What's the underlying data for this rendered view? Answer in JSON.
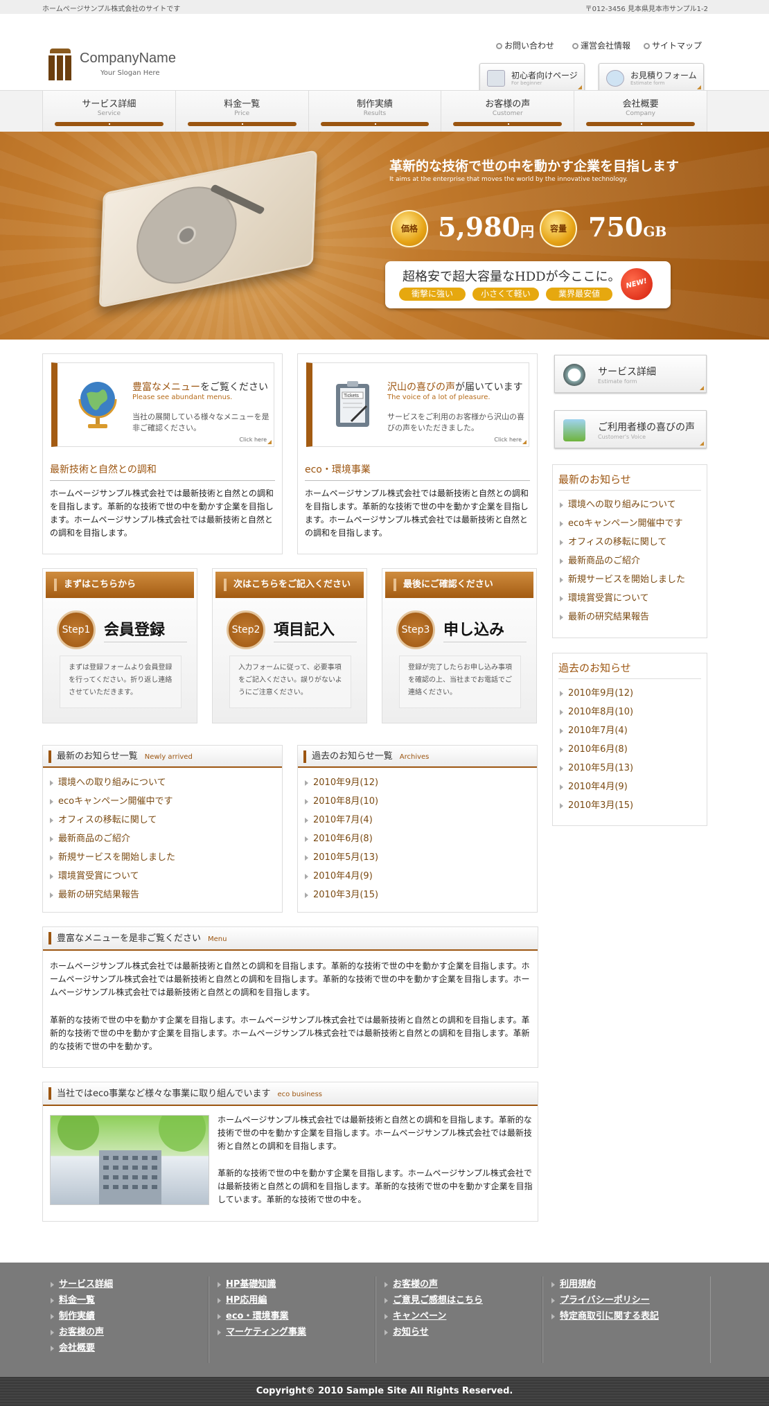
{
  "topbar": {
    "left": "ホームページサンプル株式会社のサイトです",
    "right": "〒012-3456 見本県見本市サンプル1-2"
  },
  "header": {
    "company": "CompanyName",
    "slogan": "Your Slogan Here",
    "links": [
      "お問い合わせ",
      "運営会社情報",
      "サイトマップ"
    ],
    "buttons": [
      {
        "label": "初心者向けページ",
        "sub": "For beginner"
      },
      {
        "label": "お見積りフォーム",
        "sub": "Estimate form"
      }
    ]
  },
  "nav": [
    {
      "label": "サービス詳細",
      "en": "Service"
    },
    {
      "label": "料金一覧",
      "en": "Price"
    },
    {
      "label": "制作実績",
      "en": "Results"
    },
    {
      "label": "お客様の声",
      "en": "Customer"
    },
    {
      "label": "会社概要",
      "en": "Company"
    }
  ],
  "hero": {
    "title": "革新的な技術で世の中を動かす企業を目指します",
    "subtitle": "It aims at the enterprise that moves the world by the innovative technology.",
    "price_label": "価格",
    "price_value": "5,980",
    "price_unit": "円",
    "capacity_label": "容量",
    "capacity_value": "750",
    "capacity_unit": "GB",
    "catch": "超格安で超大容量なHDDが今ここに。",
    "pills": [
      "衝撃に強い",
      "小さくて軽い",
      "業界最安値"
    ],
    "new_badge": "NEW!"
  },
  "promos": [
    {
      "title_a": "豊富なメニュー",
      "title_b": "をご覧ください",
      "sub": "Please see abundant menus.",
      "desc": "当社の展開している様々なメニューを是非ご確認ください。",
      "click": "Click here",
      "heading": "最新技術と自然との調和",
      "body": "ホームページサンプル株式会社では最新技術と自然との調和を目指します。革新的な技術で世の中を動かす企業を目指します。ホームページサンプル株式会社では最新技術と自然との調和を目指します。"
    },
    {
      "title_a": "沢山の喜びの声",
      "title_b": "が届いています",
      "sub": "The voice of a lot of pleasure.",
      "desc": "サービスをご利用のお客様から沢山の喜びの声をいただきました。",
      "click": "Click here",
      "heading": "eco・環境事業",
      "body": "ホームページサンプル株式会社では最新技術と自然との調和を目指します。革新的な技術で世の中を動かす企業を目指します。ホームページサンプル株式会社では最新技術と自然との調和を目指します。"
    }
  ],
  "steps": [
    {
      "header": "まずはこちらから",
      "badge": "Step1",
      "title": "会員登録",
      "desc": "まずは登録フォームより会員登録を行ってください。折り返し連絡させていただきます。"
    },
    {
      "header": "次はこちらをご記入ください",
      "badge": "Step2",
      "title": "項目記入",
      "desc": "入力フォームに従って、必要事項をご記入ください。誤りがないようにご注意ください。"
    },
    {
      "header": "最後にご確認ください",
      "badge": "Step3",
      "title": "申し込み",
      "desc": "登録が完了したらお申し込み事項を確認の上、当社までお電話でご連絡ください。"
    }
  ],
  "news": {
    "title": "最新のお知らせ一覧",
    "en": "Newly arrived",
    "items": [
      "環境への取り組みについて",
      "ecoキャンペーン開催中です",
      "オフィスの移転に関して",
      "最新商品のご紹介",
      "新規サービスを開始しました",
      "環境賞受賞について",
      "最新の研究結果報告"
    ]
  },
  "archives": {
    "title": "過去のお知らせ一覧",
    "en": "Archives",
    "items": [
      "2010年9月(12)",
      "2010年8月(10)",
      "2010年7月(4)",
      "2010年6月(8)",
      "2010年5月(13)",
      "2010年4月(9)",
      "2010年3月(15)"
    ]
  },
  "menu_section": {
    "title": "豊富なメニューを是非ご覧ください",
    "en": "Menu",
    "p1": "ホームページサンプル株式会社では最新技術と自然との調和を目指します。革新的な技術で世の中を動かす企業を目指します。ホームページサンプル株式会社では最新技術と自然との調和を目指します。革新的な技術で世の中を動かす企業を目指します。ホームページサンプル株式会社では最新技術と自然との調和を目指します。",
    "p2": "革新的な技術で世の中を動かす企業を目指します。ホームページサンプル株式会社では最新技術と自然との調和を目指します。革新的な技術で世の中を動かす企業を目指します。ホームページサンプル株式会社では最新技術と自然との調和を目指します。革新的な技術で世の中を動かす。"
  },
  "eco_section": {
    "title": "当社ではeco事業など様々な事業に取り組んでいます",
    "en": "eco business",
    "p1": "ホームページサンプル株式会社では最新技術と自然との調和を目指します。革新的な技術で世の中を動かす企業を目指します。ホームページサンプル株式会社では最新技術と自然との調和を目指します。",
    "p2": "革新的な技術で世の中を動かす企業を目指します。ホームページサンプル株式会社では最新技術と自然との調和を目指します。革新的な技術で世の中を動かす企業を目指しています。革新的な技術で世の中を。"
  },
  "sidebar": {
    "buttons": [
      {
        "label": "サービス詳細",
        "sub": "Estimate form"
      },
      {
        "label": "ご利用者様の喜びの声",
        "sub": "Customer's Voice"
      }
    ],
    "news_title": "最新のお知らせ",
    "news_items": [
      "環境への取り組みについて",
      "ecoキャンペーン開催中です",
      "オフィスの移転に関して",
      "最新商品のご紹介",
      "新規サービスを開始しました",
      "環境賞受賞について",
      "最新の研究結果報告"
    ],
    "archive_title": "過去のお知らせ",
    "archive_items": [
      "2010年9月(12)",
      "2010年8月(10)",
      "2010年7月(4)",
      "2010年6月(8)",
      "2010年5月(13)",
      "2010年4月(9)",
      "2010年3月(15)"
    ]
  },
  "footer": {
    "cols": [
      [
        "サービス詳細",
        "料金一覧",
        "制作実績",
        "お客様の声",
        "会社概要"
      ],
      [
        "HP基礎知識",
        "HP応用編",
        "eco・環境事業",
        "マーケティング事業"
      ],
      [
        "お客様の声",
        "ご意見ご感想はこちら",
        "キャンペーン",
        "お知らせ"
      ],
      [
        "利用規約",
        "プライバシーポリシー",
        "特定商取引に関する表記"
      ]
    ],
    "copyright": "Copyright© 2010 Sample Site All Rights Reserved."
  },
  "colors": {
    "accent": "#9c5510",
    "hero": "#c27a2c",
    "gold": "#e6a80f",
    "footer": "#7a7a7a"
  }
}
